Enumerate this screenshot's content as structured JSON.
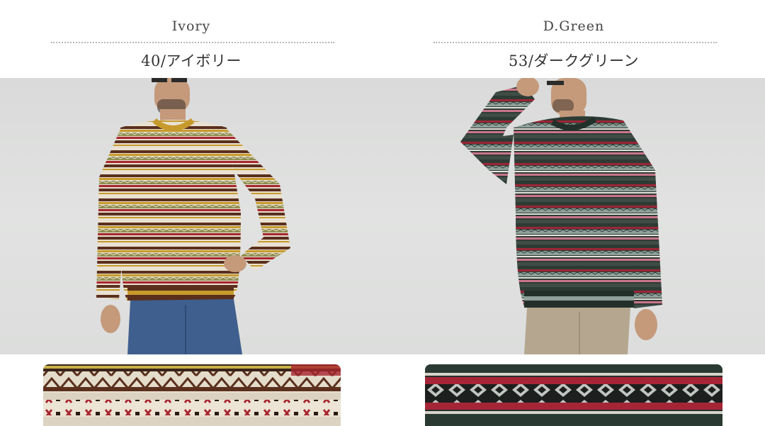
{
  "variants": [
    {
      "name": "Ivory",
      "code_label": "40/アイボリー",
      "colors": {
        "sweater_base": "#e9e1d2",
        "band_brown": "#5a2f1c",
        "band_red": "#a8252e",
        "band_gold": "#c79a2c",
        "band_olive": "#8f8f52",
        "pants": "#3f5f8e",
        "background": "#dcdcdb"
      }
    },
    {
      "name": "D.Green",
      "code_label": "53/ダークグリーン",
      "colors": {
        "sweater_base": "#2e3b35",
        "band_grey": "#8fa09a",
        "band_red": "#9c2636",
        "band_pink": "#c9748a",
        "band_white": "#e6e4de",
        "pants": "#b5a78f",
        "background": "#dcdcdb"
      }
    }
  ]
}
